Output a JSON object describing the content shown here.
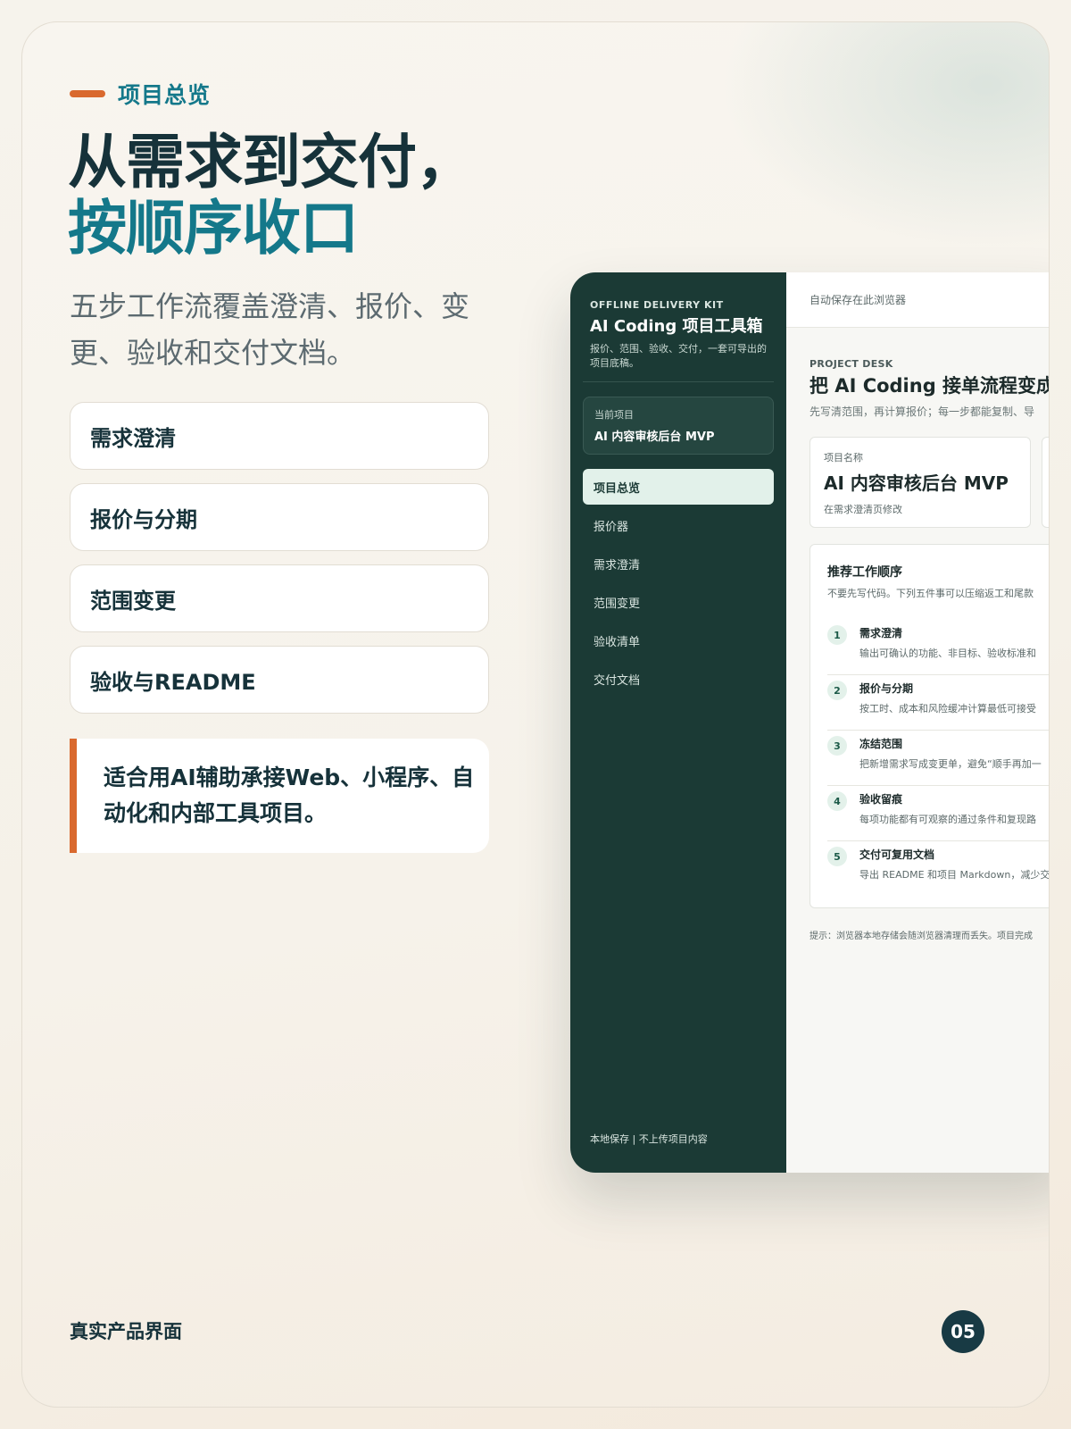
{
  "slide": {
    "eyebrow": "项目总览",
    "title_line1": "从需求到交付，",
    "title_line2": "按顺序收口",
    "subtitle": "五步工作流覆盖澄清、报价、变更、验收和交付文档。",
    "steps": [
      "需求澄清",
      "报价与分期",
      "范围变更",
      "验收与README"
    ],
    "callout": "适合用AI辅助承接Web、小程序、自动化和内部工具项目。",
    "footer": "真实产品界面",
    "page_number": "05",
    "accent_color": "#d9692e",
    "title_color": "#14788a"
  },
  "app": {
    "sidebar": {
      "kit_label": "OFFLINE DELIVERY KIT",
      "title": "AI Coding 项目工具箱",
      "description": "报价、范围、验收、交付，一套可导出的项目底稿。",
      "current_project_label": "当前项目",
      "current_project_value": "AI 内容审核后台 MVP",
      "nav": [
        {
          "label": "项目总览",
          "active": true
        },
        {
          "label": "报价器",
          "active": false
        },
        {
          "label": "需求澄清",
          "active": false
        },
        {
          "label": "范围变更",
          "active": false
        },
        {
          "label": "验收清单",
          "active": false
        },
        {
          "label": "交付文档",
          "active": false
        }
      ],
      "footer": "本地保存 | 不上传项目内容",
      "bg_color": "#1b3a35"
    },
    "topbar": {
      "status": "自动保存在此浏览器"
    },
    "main": {
      "eyebrow": "PROJECT DESK",
      "heading": "把 AI Coding 接单流程变成可",
      "subheading": "先写清范围，再计算报价；每一步都能复制、导",
      "project_card": {
        "label": "项目名称",
        "value": "AI 内容审核后台 MVP",
        "note": "在需求澄清页修改"
      },
      "workflow": {
        "title": "推荐工作顺序",
        "subtitle": "不要先写代码。下列五件事可以压缩返工和尾款",
        "items": [
          {
            "num": "1",
            "title": "需求澄清",
            "desc": "输出可确认的功能、非目标、验收标准和"
          },
          {
            "num": "2",
            "title": "报价与分期",
            "desc": "按工时、成本和风险缓冲计算最低可接受"
          },
          {
            "num": "3",
            "title": "冻结范围",
            "desc": "把新增需求写成变更单，避免“顺手再加一"
          },
          {
            "num": "4",
            "title": "验收留痕",
            "desc": "每项功能都有可观察的通过条件和复现路"
          },
          {
            "num": "5",
            "title": "交付可复用文档",
            "desc": "导出 README 和项目 Markdown，减少交"
          }
        ]
      },
      "tip": "提示：浏览器本地存储会随浏览器清理而丢失。项目完成"
    }
  }
}
